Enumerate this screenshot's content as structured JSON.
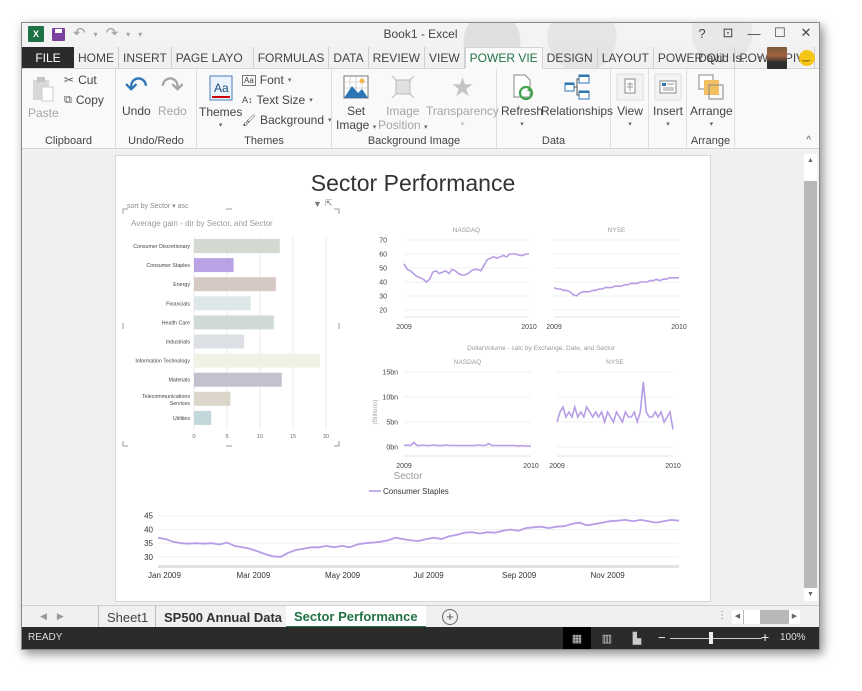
{
  "window": {
    "title": "Book1 - Excel",
    "controls": {
      "help": "?",
      "restore_ribbon": "⊡",
      "minimize": "—",
      "maximize": "☐",
      "close": "✕"
    }
  },
  "quick_access": {
    "undo_glyph": "↶",
    "redo_glyph": "↷",
    "customize": "▾"
  },
  "tabs": {
    "file": "FILE",
    "items": [
      "HOME",
      "INSERT",
      "PAGE LAYO",
      "FORMULAS",
      "DATA",
      "REVIEW",
      "VIEW",
      "POWER VIE",
      "DESIGN",
      "LAYOUT",
      "POWER QU",
      "POWERPIV"
    ],
    "active_index": 7
  },
  "user": {
    "name": "David Is...",
    "caret": "▾"
  },
  "ribbon": {
    "clipboard": {
      "label": "Clipboard",
      "paste": "Paste",
      "cut": "Cut",
      "copy": "Copy"
    },
    "undo_redo": {
      "label": "Undo/Redo",
      "undo": "Undo",
      "redo": "Redo"
    },
    "themes": {
      "label": "Themes",
      "themes": "Themes",
      "font": "Font",
      "text_size": "Text Size",
      "background": "Background"
    },
    "background_image": {
      "label": "Background Image",
      "set_image_1": "Set",
      "set_image_2": "Image",
      "image_position_1": "Image",
      "image_position_2": "Position",
      "transparency": "Transparency"
    },
    "data": {
      "label": "Data",
      "refresh": "Refresh",
      "relationships": "Relationships"
    },
    "view": {
      "label": "View"
    },
    "insert": {
      "label": "Insert"
    },
    "arrange": {
      "label": "Arrange",
      "arrange": "Arrange"
    },
    "collapse_glyph": "^"
  },
  "report": {
    "title": "Sector Performance",
    "sort_label": "sort by  Sector  ▾  asc"
  },
  "chart_data": [
    {
      "type": "bar",
      "orientation": "horizontal",
      "title": "Average gain - dir by Sector, and Sector",
      "categories": [
        "Consumer Discretionary",
        "Consumer Staples",
        "Energy",
        "Financials",
        "Health Care",
        "Industrials",
        "Information Technology",
        "Materials",
        "Telecommunications Services",
        "Utilities"
      ],
      "values": [
        13.0,
        6.0,
        12.4,
        8.6,
        12.1,
        7.6,
        19.1,
        13.3,
        5.5,
        2.6
      ],
      "colors": [
        "#d3d8d0",
        "#b9a3e5",
        "#d6c8c3",
        "#dfe8e8",
        "#d0dad5",
        "#dcdfe3",
        "#f0f2e6",
        "#c4c0d0",
        "#dcd5ca",
        "#c2d7d9"
      ],
      "xticks": [
        "0",
        "5",
        "10",
        "15",
        "20"
      ],
      "xlim": [
        0,
        20
      ],
      "grid": true
    },
    {
      "type": "line",
      "title": "",
      "panels": [
        "NASDAQ",
        "NYSE"
      ],
      "yticks": [
        "20",
        "30",
        "40",
        "50",
        "60",
        "70"
      ],
      "ylim": [
        15,
        70
      ],
      "xticks": [
        "2009",
        "2010"
      ],
      "series": [
        {
          "name": "NASDAQ",
          "values": [
            53,
            49,
            48,
            46,
            44,
            43,
            42,
            40,
            42,
            47,
            48,
            46,
            47,
            48,
            46,
            49,
            48,
            46,
            45,
            45,
            46,
            48,
            49,
            49,
            48,
            52,
            56,
            57,
            58,
            57,
            58,
            59,
            58,
            60,
            60,
            60,
            59,
            59,
            60,
            60
          ]
        },
        {
          "name": "NYSE",
          "values": [
            36,
            35,
            35,
            34,
            34,
            33,
            31,
            30,
            32,
            33,
            33,
            33,
            34,
            34,
            35,
            35,
            36,
            36,
            36,
            37,
            37,
            37,
            38,
            38,
            39,
            39,
            39,
            40,
            40,
            40,
            41,
            41,
            42,
            41,
            42,
            42,
            43,
            43,
            43,
            43
          ]
        }
      ],
      "color": "#b79de6"
    },
    {
      "type": "line",
      "title": "DollarVolume - calc by Exchange, Date, and Sector",
      "panels": [
        "NASDAQ",
        "NYSE"
      ],
      "ylabel": "(Billions)",
      "yticks": [
        "0bn",
        "5bn",
        "10bn",
        "15bn"
      ],
      "ylim": [
        -1,
        15
      ],
      "xticks": [
        "2009",
        "2010"
      ],
      "series": [
        {
          "name": "NASDAQ",
          "values": [
            0.3,
            0.4,
            0.3,
            0.9,
            0.3,
            0.3,
            0.4,
            0.3,
            0.3,
            0.4,
            0.3,
            0.3,
            0.3,
            0.4,
            0.3,
            0.3,
            0.3,
            0.3,
            0.3,
            0.3,
            0.3,
            0.3,
            0.3,
            0.4,
            0.3,
            0.3,
            0.7,
            0.3,
            0.3,
            0.3,
            0.3,
            0.3,
            0.3,
            0.3,
            0.3,
            0.2,
            0.3,
            0.2,
            0.2,
            0.2
          ]
        },
        {
          "name": "NYSE",
          "values": [
            5,
            7,
            8,
            6,
            7,
            6,
            8,
            6,
            7,
            6,
            8,
            7,
            6,
            7,
            6,
            7,
            5,
            7,
            6,
            5,
            7,
            6,
            5,
            7,
            6,
            6,
            7,
            5,
            7,
            13,
            7,
            6,
            6,
            7,
            6,
            7,
            5,
            6,
            7,
            3.5
          ]
        }
      ],
      "color": "#b79de6"
    },
    {
      "type": "line",
      "title": "Sector",
      "legend": [
        "Consumer Staples"
      ],
      "legend_position": "top-center",
      "yticks": [
        "30",
        "35",
        "40",
        "45"
      ],
      "ylim": [
        28.5,
        46
      ],
      "xticks": [
        "Jan 2009",
        "Mar 2009",
        "May 2009",
        "Jul 2009",
        "Sep 2009",
        "Nov 2009"
      ],
      "series": [
        {
          "name": "Consumer Staples",
          "values": [
            37,
            36.5,
            35.5,
            35,
            34.8,
            35,
            34.8,
            35,
            34.5,
            35.2,
            34,
            33.5,
            33,
            32,
            31,
            30.2,
            30,
            31.5,
            32.5,
            33,
            33.5,
            33.5,
            34,
            33.5,
            34,
            33.5,
            34.5,
            35,
            35.2,
            35.5,
            36,
            37,
            36.5,
            36,
            35.8,
            36.5,
            37,
            36.5,
            37.5,
            38,
            38.8,
            39,
            38.5,
            39,
            38.8,
            39.5,
            40,
            39.5,
            40.5,
            40.8,
            41,
            40.5,
            41,
            41.2,
            42,
            42.5,
            41.5,
            42,
            42.5,
            43,
            43.2,
            43.5,
            43,
            43.5,
            43,
            42.5,
            43,
            43.5,
            43.2
          ]
        }
      ],
      "color": "#b79de6"
    }
  ],
  "sheet_tabs": {
    "items": [
      "Sheet1",
      "SP500 Annual Data",
      "Sector Performance"
    ],
    "active_index": 2,
    "add": "+"
  },
  "statusbar": {
    "status": "READY",
    "zoom": "100%",
    "zoom_level": 1.0
  }
}
